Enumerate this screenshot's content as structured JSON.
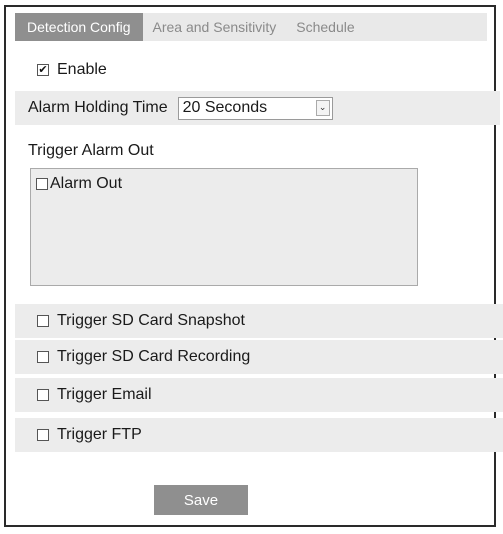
{
  "tabs": [
    {
      "label": "Detection Config",
      "active": true
    },
    {
      "label": "Area and Sensitivity",
      "active": false
    },
    {
      "label": "Schedule",
      "active": false
    }
  ],
  "enable": {
    "label": "Enable",
    "checked": true
  },
  "alarm_holding": {
    "label": "Alarm Holding Time",
    "value": "20 Seconds"
  },
  "trigger_alarm_out": {
    "label": "Trigger Alarm Out",
    "items": [
      {
        "label": "Alarm Out",
        "checked": false
      }
    ]
  },
  "triggers": [
    {
      "label": "Trigger SD Card Snapshot",
      "checked": false
    },
    {
      "label": "Trigger SD Card Recording",
      "checked": false
    },
    {
      "label": "Trigger Email",
      "checked": false
    },
    {
      "label": "Trigger FTP",
      "checked": false
    }
  ],
  "save_label": "Save",
  "colors": {
    "accent": "#8f8f8f",
    "row_shade": "#ececec"
  },
  "icons": {
    "checked_glyph": "✔",
    "dropdown_glyph": "⌄"
  }
}
